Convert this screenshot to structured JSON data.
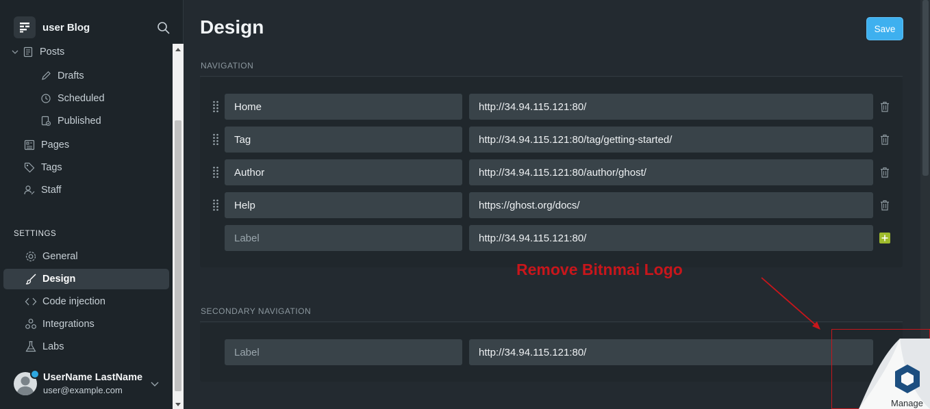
{
  "sidebar": {
    "brand_name": "user Blog",
    "items": [
      {
        "label": "Posts",
        "icon": "posts-icon"
      },
      {
        "label": "Drafts",
        "icon": "pencil-icon"
      },
      {
        "label": "Scheduled",
        "icon": "clock-icon"
      },
      {
        "label": "Published",
        "icon": "published-icon"
      },
      {
        "label": "Pages",
        "icon": "pages-icon"
      },
      {
        "label": "Tags",
        "icon": "tag-icon"
      },
      {
        "label": "Staff",
        "icon": "staff-icon"
      }
    ],
    "settings_label": "SETTINGS",
    "settings_items": [
      {
        "label": "General",
        "icon": "gear-icon"
      },
      {
        "label": "Design",
        "icon": "brush-icon",
        "active": true
      },
      {
        "label": "Code injection",
        "icon": "code-icon"
      },
      {
        "label": "Integrations",
        "icon": "integrations-icon"
      },
      {
        "label": "Labs",
        "icon": "flask-icon"
      }
    ],
    "user": {
      "name": "UserName LastName",
      "email": "user@example.com"
    }
  },
  "main": {
    "title": "Design",
    "save_label": "Save",
    "navigation_label": "NAVIGATION",
    "navigation": [
      {
        "label": "Home",
        "url": "http://34.94.115.121:80/"
      },
      {
        "label": "Tag",
        "url": "http://34.94.115.121:80/tag/getting-started/"
      },
      {
        "label": "Author",
        "url": "http://34.94.115.121:80/author/ghost/"
      },
      {
        "label": "Help",
        "url": "https://ghost.org/docs/"
      }
    ],
    "new_navigation": {
      "label_placeholder": "Label",
      "url": "http://34.94.115.121:80/"
    },
    "secondary_label": "SECONDARY NAVIGATION",
    "secondary_new": {
      "label_placeholder": "Label",
      "url": "http://34.94.115.121:80/"
    }
  },
  "annotation": {
    "text": "Remove Bitnmai Logo",
    "badge_label": "Manage",
    "color": "#c8161b"
  },
  "colors": {
    "accent": "#3eb0ef",
    "add_green": "#9fbb2c"
  }
}
